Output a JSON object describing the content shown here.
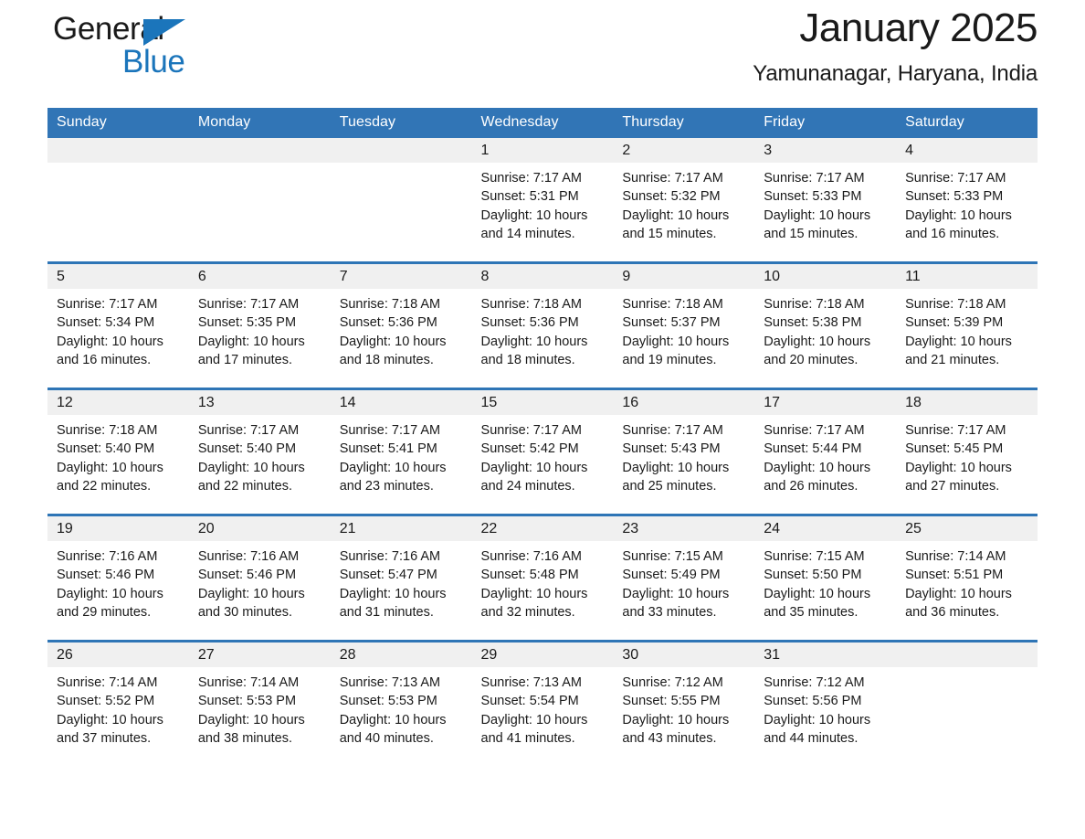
{
  "brand": {
    "word1": "General",
    "word2": "Blue",
    "accent_color": "#1b75bb",
    "triangle_icon": "brand-triangle-icon"
  },
  "header": {
    "title": "January 2025",
    "location": "Yamunanagar, Haryana, India"
  },
  "theme": {
    "header_blue": "#3175b6",
    "row_rule_blue": "#2e75b6",
    "daynum_band": "#f0f0f0",
    "text": "#1a1a1a"
  },
  "weekday_headers": [
    "Sunday",
    "Monday",
    "Tuesday",
    "Wednesday",
    "Thursday",
    "Friday",
    "Saturday"
  ],
  "weeks": [
    [
      {
        "day": "",
        "empty": true,
        "sunrise": "",
        "sunset": "",
        "daylight1": "",
        "daylight2": ""
      },
      {
        "day": "",
        "empty": true,
        "sunrise": "",
        "sunset": "",
        "daylight1": "",
        "daylight2": ""
      },
      {
        "day": "",
        "empty": true,
        "sunrise": "",
        "sunset": "",
        "daylight1": "",
        "daylight2": ""
      },
      {
        "day": "1",
        "sunrise": "Sunrise: 7:17 AM",
        "sunset": "Sunset: 5:31 PM",
        "daylight1": "Daylight: 10 hours",
        "daylight2": "and 14 minutes."
      },
      {
        "day": "2",
        "sunrise": "Sunrise: 7:17 AM",
        "sunset": "Sunset: 5:32 PM",
        "daylight1": "Daylight: 10 hours",
        "daylight2": "and 15 minutes."
      },
      {
        "day": "3",
        "sunrise": "Sunrise: 7:17 AM",
        "sunset": "Sunset: 5:33 PM",
        "daylight1": "Daylight: 10 hours",
        "daylight2": "and 15 minutes."
      },
      {
        "day": "4",
        "sunrise": "Sunrise: 7:17 AM",
        "sunset": "Sunset: 5:33 PM",
        "daylight1": "Daylight: 10 hours",
        "daylight2": "and 16 minutes."
      }
    ],
    [
      {
        "day": "5",
        "sunrise": "Sunrise: 7:17 AM",
        "sunset": "Sunset: 5:34 PM",
        "daylight1": "Daylight: 10 hours",
        "daylight2": "and 16 minutes."
      },
      {
        "day": "6",
        "sunrise": "Sunrise: 7:17 AM",
        "sunset": "Sunset: 5:35 PM",
        "daylight1": "Daylight: 10 hours",
        "daylight2": "and 17 minutes."
      },
      {
        "day": "7",
        "sunrise": "Sunrise: 7:18 AM",
        "sunset": "Sunset: 5:36 PM",
        "daylight1": "Daylight: 10 hours",
        "daylight2": "and 18 minutes."
      },
      {
        "day": "8",
        "sunrise": "Sunrise: 7:18 AM",
        "sunset": "Sunset: 5:36 PM",
        "daylight1": "Daylight: 10 hours",
        "daylight2": "and 18 minutes."
      },
      {
        "day": "9",
        "sunrise": "Sunrise: 7:18 AM",
        "sunset": "Sunset: 5:37 PM",
        "daylight1": "Daylight: 10 hours",
        "daylight2": "and 19 minutes."
      },
      {
        "day": "10",
        "sunrise": "Sunrise: 7:18 AM",
        "sunset": "Sunset: 5:38 PM",
        "daylight1": "Daylight: 10 hours",
        "daylight2": "and 20 minutes."
      },
      {
        "day": "11",
        "sunrise": "Sunrise: 7:18 AM",
        "sunset": "Sunset: 5:39 PM",
        "daylight1": "Daylight: 10 hours",
        "daylight2": "and 21 minutes."
      }
    ],
    [
      {
        "day": "12",
        "sunrise": "Sunrise: 7:18 AM",
        "sunset": "Sunset: 5:40 PM",
        "daylight1": "Daylight: 10 hours",
        "daylight2": "and 22 minutes."
      },
      {
        "day": "13",
        "sunrise": "Sunrise: 7:17 AM",
        "sunset": "Sunset: 5:40 PM",
        "daylight1": "Daylight: 10 hours",
        "daylight2": "and 22 minutes."
      },
      {
        "day": "14",
        "sunrise": "Sunrise: 7:17 AM",
        "sunset": "Sunset: 5:41 PM",
        "daylight1": "Daylight: 10 hours",
        "daylight2": "and 23 minutes."
      },
      {
        "day": "15",
        "sunrise": "Sunrise: 7:17 AM",
        "sunset": "Sunset: 5:42 PM",
        "daylight1": "Daylight: 10 hours",
        "daylight2": "and 24 minutes."
      },
      {
        "day": "16",
        "sunrise": "Sunrise: 7:17 AM",
        "sunset": "Sunset: 5:43 PM",
        "daylight1": "Daylight: 10 hours",
        "daylight2": "and 25 minutes."
      },
      {
        "day": "17",
        "sunrise": "Sunrise: 7:17 AM",
        "sunset": "Sunset: 5:44 PM",
        "daylight1": "Daylight: 10 hours",
        "daylight2": "and 26 minutes."
      },
      {
        "day": "18",
        "sunrise": "Sunrise: 7:17 AM",
        "sunset": "Sunset: 5:45 PM",
        "daylight1": "Daylight: 10 hours",
        "daylight2": "and 27 minutes."
      }
    ],
    [
      {
        "day": "19",
        "sunrise": "Sunrise: 7:16 AM",
        "sunset": "Sunset: 5:46 PM",
        "daylight1": "Daylight: 10 hours",
        "daylight2": "and 29 minutes."
      },
      {
        "day": "20",
        "sunrise": "Sunrise: 7:16 AM",
        "sunset": "Sunset: 5:46 PM",
        "daylight1": "Daylight: 10 hours",
        "daylight2": "and 30 minutes."
      },
      {
        "day": "21",
        "sunrise": "Sunrise: 7:16 AM",
        "sunset": "Sunset: 5:47 PM",
        "daylight1": "Daylight: 10 hours",
        "daylight2": "and 31 minutes."
      },
      {
        "day": "22",
        "sunrise": "Sunrise: 7:16 AM",
        "sunset": "Sunset: 5:48 PM",
        "daylight1": "Daylight: 10 hours",
        "daylight2": "and 32 minutes."
      },
      {
        "day": "23",
        "sunrise": "Sunrise: 7:15 AM",
        "sunset": "Sunset: 5:49 PM",
        "daylight1": "Daylight: 10 hours",
        "daylight2": "and 33 minutes."
      },
      {
        "day": "24",
        "sunrise": "Sunrise: 7:15 AM",
        "sunset": "Sunset: 5:50 PM",
        "daylight1": "Daylight: 10 hours",
        "daylight2": "and 35 minutes."
      },
      {
        "day": "25",
        "sunrise": "Sunrise: 7:14 AM",
        "sunset": "Sunset: 5:51 PM",
        "daylight1": "Daylight: 10 hours",
        "daylight2": "and 36 minutes."
      }
    ],
    [
      {
        "day": "26",
        "sunrise": "Sunrise: 7:14 AM",
        "sunset": "Sunset: 5:52 PM",
        "daylight1": "Daylight: 10 hours",
        "daylight2": "and 37 minutes."
      },
      {
        "day": "27",
        "sunrise": "Sunrise: 7:14 AM",
        "sunset": "Sunset: 5:53 PM",
        "daylight1": "Daylight: 10 hours",
        "daylight2": "and 38 minutes."
      },
      {
        "day": "28",
        "sunrise": "Sunrise: 7:13 AM",
        "sunset": "Sunset: 5:53 PM",
        "daylight1": "Daylight: 10 hours",
        "daylight2": "and 40 minutes."
      },
      {
        "day": "29",
        "sunrise": "Sunrise: 7:13 AM",
        "sunset": "Sunset: 5:54 PM",
        "daylight1": "Daylight: 10 hours",
        "daylight2": "and 41 minutes."
      },
      {
        "day": "30",
        "sunrise": "Sunrise: 7:12 AM",
        "sunset": "Sunset: 5:55 PM",
        "daylight1": "Daylight: 10 hours",
        "daylight2": "and 43 minutes."
      },
      {
        "day": "31",
        "sunrise": "Sunrise: 7:12 AM",
        "sunset": "Sunset: 5:56 PM",
        "daylight1": "Daylight: 10 hours",
        "daylight2": "and 44 minutes."
      },
      {
        "day": "",
        "empty": true,
        "sunrise": "",
        "sunset": "",
        "daylight1": "",
        "daylight2": ""
      }
    ]
  ]
}
